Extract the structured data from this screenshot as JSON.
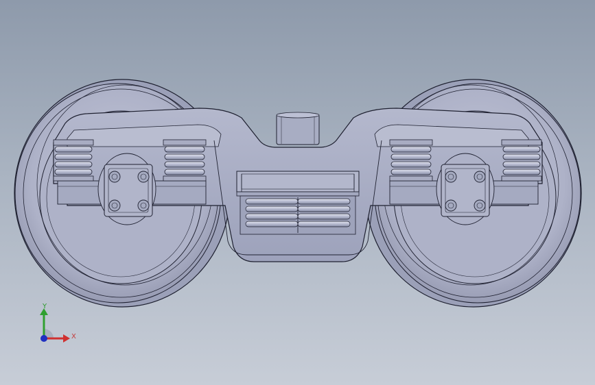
{
  "viewport": {
    "background_top": "#8e9aab",
    "background_bottom": "#c7cdd7"
  },
  "model": {
    "part_color": "#a9aec6",
    "edge_color": "#1e2030",
    "spring_color": "#b9bdd2"
  },
  "triad": {
    "x_label": "X",
    "y_label": "Y",
    "x_color": "#d03030",
    "y_color": "#30a030",
    "z_color": "#2030c0"
  }
}
